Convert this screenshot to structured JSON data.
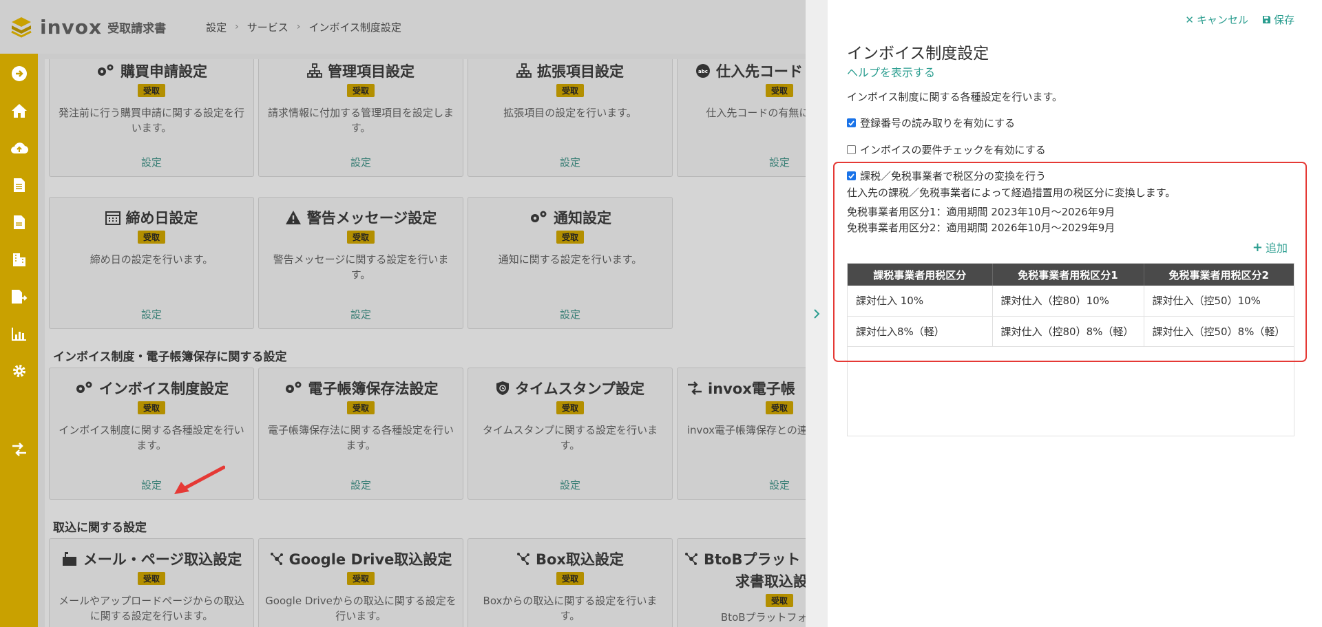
{
  "app": {
    "brand": "invox",
    "product": "受取請求書"
  },
  "breadcrumb": [
    "設定",
    "サービス",
    "インボイス制度設定"
  ],
  "sidebar": {
    "icons": [
      "arrow-right-circle-icon",
      "home-icon",
      "cloud-upload-icon",
      "document-icon",
      "document-lines-icon",
      "building-icon",
      "export-document-icon",
      "chart-icon",
      "gear-icon",
      "exchange-icon"
    ]
  },
  "cards_row1": [
    {
      "title": "購買申請設定",
      "badge": "受取",
      "desc": "発注前に行う購買申請に関する設定を行います。",
      "link": "設定"
    },
    {
      "title": "管理項目設定",
      "badge": "受取",
      "desc": "請求情報に付加する管理項目を設定します。",
      "link": "設定"
    },
    {
      "title": "拡張項目設定",
      "badge": "受取",
      "desc": "拡張項目の設定を行います。",
      "link": "設定"
    },
    {
      "title": "仕入先コード",
      "badge": "受取",
      "desc": "仕入先コードの有無によ ます。",
      "link": "設定"
    }
  ],
  "cards_row2": [
    {
      "title": "締め日設定",
      "badge": "受取",
      "desc": "締め日の設定を行います。",
      "link": "設定"
    },
    {
      "title": "警告メッセージ設定",
      "badge": "受取",
      "desc": "警告メッセージに関する設定を行います。",
      "link": "設定"
    },
    {
      "title": "通知設定",
      "badge": "受取",
      "desc": "通知に関する設定を行います。",
      "link": "設定"
    }
  ],
  "section_invoice": "インボイス制度・電子帳簿保存に関する設定",
  "cards_row3": [
    {
      "title": "インボイス制度設定",
      "badge": "受取",
      "desc": "インボイス制度に関する各種設定を行います。",
      "link": "設定"
    },
    {
      "title": "電子帳簿保存法設定",
      "badge": "受取",
      "desc": "電子帳簿保存法に関する各種設定を行います。",
      "link": "設定"
    },
    {
      "title": "タイムスタンプ設定",
      "badge": "受取",
      "desc": "タイムスタンプに関する設定を行います。",
      "link": "設定"
    },
    {
      "title": "invox電子帳",
      "badge": "受取",
      "desc": "invox電子帳簿保存との連 を行います。",
      "link": "設定"
    }
  ],
  "section_import": "取込に関する設定",
  "cards_row4": [
    {
      "title": "メール・ページ取込設定",
      "badge": "受取",
      "desc": "メールやアップロードページからの取込に関する設定を行います。"
    },
    {
      "title": "Google Drive取込設定",
      "badge": "受取",
      "desc": "Google Driveからの取込に関する設定を行います。"
    },
    {
      "title": "Box取込設定",
      "badge": "受取",
      "desc": "Boxからの取込に関する設定を行います。"
    },
    {
      "title": "BtoBプラット",
      "title2": "求書取込設",
      "badge": "受取",
      "desc": "BtoBプラットフォーム請"
    }
  ],
  "panel": {
    "cancel_label": "キャンセル",
    "save_label": "保存",
    "title": "インボイス制度設定",
    "help_link": "ヘルプを表示する",
    "description": "インボイス制度に関する各種設定を行います。",
    "options": [
      {
        "label": "登録番号の読み取りを有効にする",
        "checked": true
      },
      {
        "label": "インボイスの要件チェックを有効にする",
        "checked": false
      },
      {
        "label": "課税／免税事業者で税区分の変換を行う",
        "checked": true
      }
    ],
    "conversion_desc": "仕入先の課税／免税事業者によって経過措置用の税区分に変換します。",
    "period1": "免税事業者用区分1：適用期間 2023年10月〜2026年9月",
    "period2": "免税事業者用区分2：適用期間 2026年10月〜2029年9月",
    "add_label": "追加",
    "table": {
      "headers": [
        "課税事業者用税区分",
        "免税事業者用税区分1",
        "免税事業者用税区分2"
      ],
      "rows": [
        [
          "課対仕入 10%",
          "課対仕入（控80）10%",
          "課対仕入（控50）10%"
        ],
        [
          "課対仕入8%（軽）",
          "課対仕入（控80）8%（軽）",
          "課対仕入（控50）8%（軽）"
        ]
      ]
    }
  },
  "colors": {
    "accent": "#2a9d8f",
    "sidebar": "#c9a100",
    "highlight": "#e53935",
    "badge": "#b38f00"
  }
}
